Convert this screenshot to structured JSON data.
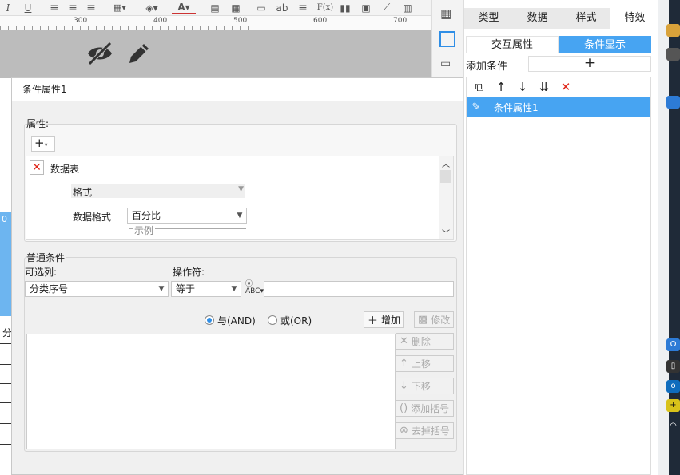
{
  "toolbar": {
    "icons": [
      "italic-icon",
      "underline-icon",
      "align-left-icon",
      "align-center-icon",
      "align-right-icon",
      "border-icon",
      "fill-color-icon",
      "font-color-icon",
      "merge-icon",
      "cell-icon",
      "ab-icon",
      "wrap-icon",
      "formula-icon",
      "chart-icon",
      "image-icon",
      "slash-icon",
      "file-icon"
    ],
    "italic": "I",
    "underline": "U",
    "ab": "ab",
    "formula": "F(x)",
    "font_color": "A"
  },
  "ruler": {
    "marks": [
      "300",
      "400",
      "500",
      "600",
      "700"
    ]
  },
  "left_strip": {
    "cell_char": "分",
    "cell_value": "0"
  },
  "dialog": {
    "title": "条件属性1",
    "attributes_group": {
      "label": "属性:",
      "add_button": "+",
      "item_title": "数据表",
      "format_label": "格式",
      "data_format_label": "数据格式",
      "data_format_value": "百分比",
      "example_label": "示例"
    },
    "conditions_group": {
      "label": "普通条件",
      "column_label": "可选列:",
      "column_value": "分类序号",
      "operator_label": "操作符:",
      "operator_value": "等于",
      "value_input": "",
      "and_label": "与(AND)",
      "or_label": "或(OR)",
      "logic_selected": "AND",
      "add_button": "增加",
      "modify_button": "修改",
      "delete_button": "删除",
      "move_up_button": "上移",
      "move_down_button": "下移",
      "add_bracket_button": "添加括号",
      "remove_bracket_button": "去掉括号"
    }
  },
  "right_panel": {
    "tabs": [
      "类型",
      "数据",
      "样式",
      "特效"
    ],
    "active_tab": "特效",
    "subtabs": [
      "交互属性",
      "条件显示"
    ],
    "active_subtab": "条件显示",
    "add_condition_label": "添加条件",
    "add_condition_button": "+",
    "condition_items": [
      "条件属性1"
    ]
  },
  "colors": {
    "accent": "#47a4f2",
    "delete_red": "#e0271a",
    "dark_strip": "#1f2a38"
  }
}
